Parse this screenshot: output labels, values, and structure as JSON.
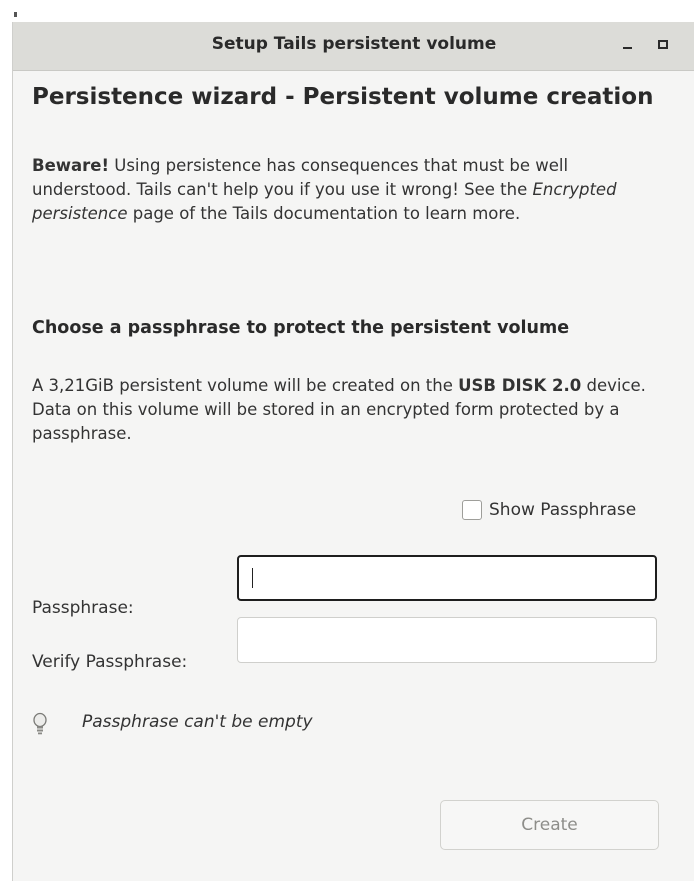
{
  "window": {
    "title": "Setup Tails persistent volume"
  },
  "wizard": {
    "heading": "Persistence wizard - Persistent volume creation",
    "warning": {
      "bold_prefix": "Beware!",
      "text_1": " Using persistence has consequences that must be well understood. Tails can't help you if you use it wrong! See the ",
      "italic_link": "Encrypted persistence",
      "text_2": " page of the Tails documentation to learn more."
    },
    "subheading": "Choose a passphrase to protect the persistent volume",
    "info": {
      "text_1": "A 3,21GiB persistent volume will be created on the ",
      "device": "USB DISK 2.0",
      "text_2": " device. Data on this volume will be stored in an encrypted form protected by a passphrase."
    },
    "show_passphrase_label": "Show Passphrase",
    "passphrase_label": "Passphrase:",
    "passphrase_value": "",
    "verify_label": "Verify Passphrase:",
    "verify_value": "",
    "hint": "Passphrase can't be empty",
    "create_label": "Create"
  },
  "icons": {
    "minimize": "minimize-icon",
    "maximize": "maximize-icon",
    "hint": "lightbulb-icon"
  }
}
